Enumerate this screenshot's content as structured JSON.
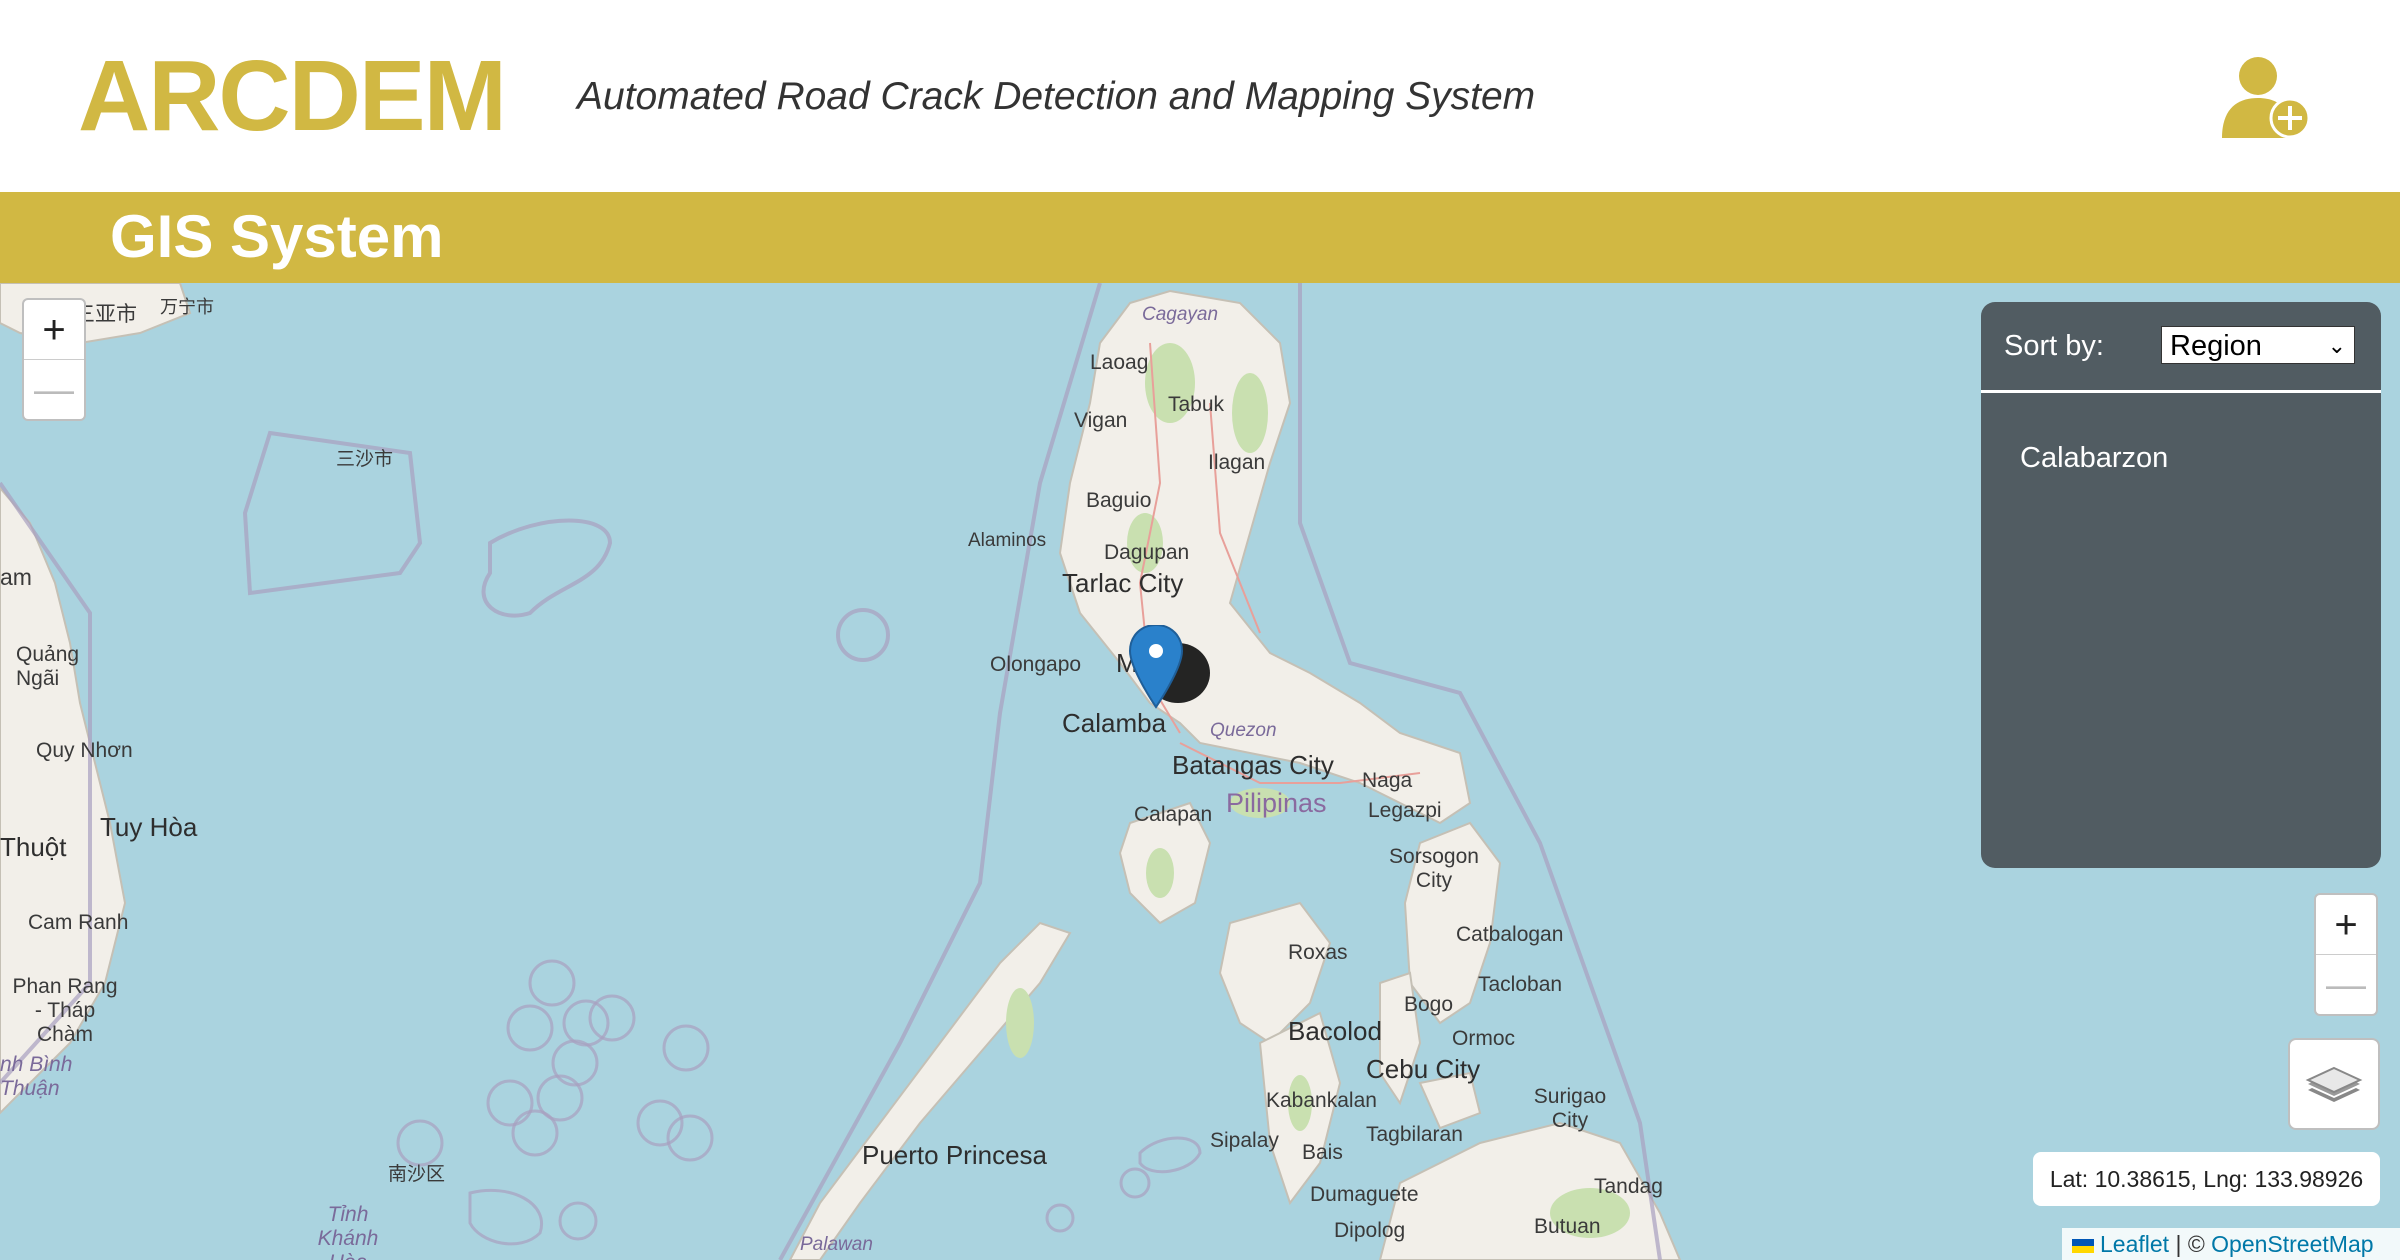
{
  "header": {
    "logo": "ARCDEM",
    "tagline": "Automated Road Crack Detection and Mapping System",
    "user_icon": "user-add-icon"
  },
  "band": {
    "title": "GIS System"
  },
  "map": {
    "zoom_in": "+",
    "zoom_out": "—",
    "labels": {
      "sanya": "三亚市",
      "wanning": "万宁市",
      "sansha": "三沙市",
      "am": "am",
      "quang_ngai": "Quảng Ngãi",
      "quy_nhon": "Quy Nhơn",
      "tuy_hoa": "Tuy Hòa",
      "thuot": "Thuột",
      "cam_ranh": "Cam Ranh",
      "phan_rang": "Phan Rang - Tháp Chàm",
      "binh_thuan": "nh Bình Thuận",
      "nansha": "南沙区",
      "tinh_khanh_hoa": "Tỉnh Khánh Hòa",
      "cagayan": "Cagayan",
      "laoag": "Laoag",
      "vigan": "Vigan",
      "tabuk": "Tabuk",
      "ilagan": "Ilagan",
      "baguio": "Baguio",
      "alaminos": "Alaminos",
      "dagupan": "Dagupan",
      "tarlac": "Tarlac City",
      "olongapo": "Olongapo",
      "calamba": "Calamba",
      "quezon": "Quezon",
      "batangas": "Batangas City",
      "naga": "Naga",
      "legazpi": "Legazpi",
      "calapan": "Calapan",
      "pilipinas": "Pilipinas",
      "sorsogon": "Sorsogon City",
      "catbalogan": "Catbalogan",
      "roxas": "Roxas",
      "tacloban": "Tacloban",
      "bogo": "Bogo",
      "ormoc": "Ormoc",
      "bacolod": "Bacolod",
      "cebu": "Cebu City",
      "kabankalan": "Kabankalan",
      "surigao": "Surigao City",
      "tagbilaran": "Tagbilaran",
      "sipalay": "Sipalay",
      "bais": "Bais",
      "puerto_princesa": "Puerto Princesa",
      "dumaguete": "Dumaguete",
      "tandag": "Tandag",
      "dipolog": "Dipolog",
      "butuan": "Butuan",
      "palawan": "Palawan",
      "m": "M"
    }
  },
  "panel": {
    "sort_label": "Sort by:",
    "sort_value": "Region",
    "regions": [
      "Calabarzon"
    ]
  },
  "controls": {
    "zoom_in": "+",
    "zoom_out": "—",
    "layers_icon": "layers-icon"
  },
  "coords": "Lat: 10.38615, Lng: 133.98926",
  "attribution": {
    "leaflet": "Leaflet",
    "separator": "| ©",
    "osm": "OpenStreetMap"
  },
  "colors": {
    "accent": "#d1b843",
    "water": "#aad3df",
    "land": "#f2efe9",
    "panel": "#515c62",
    "marker": "#2a81cb"
  }
}
